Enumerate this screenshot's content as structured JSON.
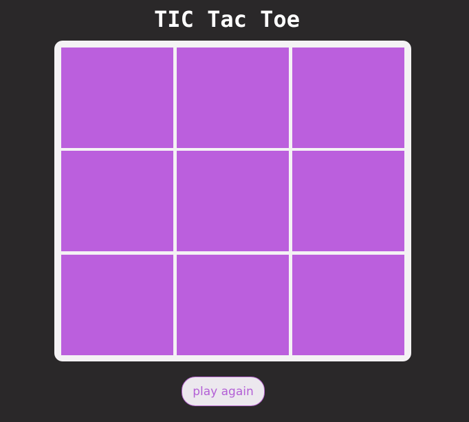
{
  "game": {
    "title": "TIC Tac Toe",
    "play_again_label": "play again",
    "board": {
      "cells": [
        "",
        "",
        "",
        "",
        "",
        "",
        "",
        "",
        ""
      ]
    },
    "colors": {
      "background": "#2a2829",
      "board_frame": "#f4f2f4",
      "cell": "#bb5fdd",
      "title": "#ffffff",
      "button_bg": "#ece8ee",
      "button_text": "#b35fd6"
    }
  }
}
